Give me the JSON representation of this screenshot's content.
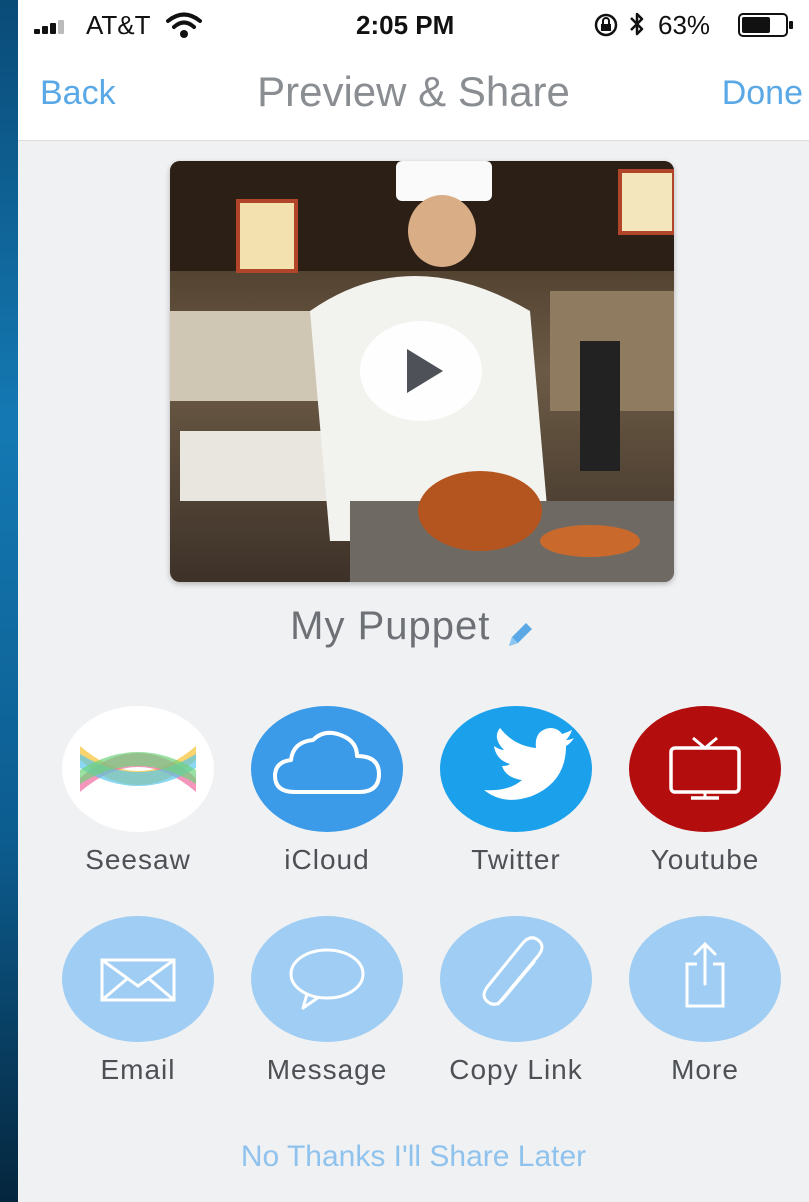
{
  "status": {
    "carrier": "AT&T",
    "time": "2:05 PM",
    "battery": "63%"
  },
  "nav": {
    "back": "Back",
    "title": "Preview & Share",
    "done": "Done"
  },
  "video": {
    "name": "My Puppet"
  },
  "share_primary": [
    {
      "label": "Seesaw",
      "icon": "seesaw-icon",
      "color": "#ffffff"
    },
    {
      "label": "iCloud",
      "icon": "cloud-icon",
      "color": "#3b9be9"
    },
    {
      "label": "Twitter",
      "icon": "twitter-bird-icon",
      "color": "#1ba1ec"
    },
    {
      "label": "Youtube",
      "icon": "tv-icon",
      "color": "#b40d0d"
    }
  ],
  "share_secondary": [
    {
      "label": "Email",
      "icon": "envelope-icon",
      "color": "#9fcdf3"
    },
    {
      "label": "Message",
      "icon": "speech-bubble-icon",
      "color": "#9fcdf3"
    },
    {
      "label": "Copy Link",
      "icon": "paperclip-icon",
      "color": "#9fcdf3"
    },
    {
      "label": "More",
      "icon": "share-icon",
      "color": "#9fcdf3"
    }
  ],
  "footer": {
    "later": "No Thanks I'll Share Later"
  }
}
